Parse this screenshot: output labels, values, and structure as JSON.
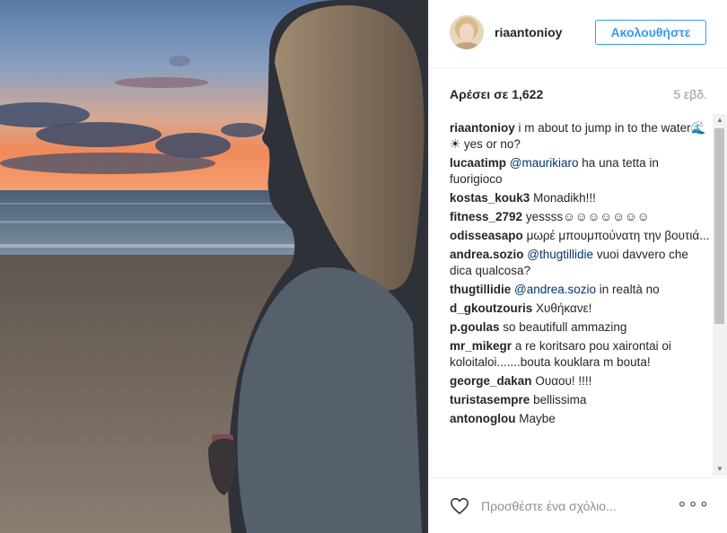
{
  "post": {
    "username": "riaantonioy",
    "follow_label": "Ακολουθήστε",
    "likes_text": "Αρέσει σε 1,622",
    "time_ago": "5 εβδ."
  },
  "comments": [
    {
      "user": "riaantonioy",
      "mention": "",
      "text": "i m about to jump in to the water🌊☀ yes or no?"
    },
    {
      "user": "lucaatimp",
      "mention": "@maurikiaro",
      "text": "ha una tetta in fuorigioco"
    },
    {
      "user": "kostas_kouk3",
      "mention": "",
      "text": "Monadikh!!!"
    },
    {
      "user": "fitness_2792",
      "mention": "",
      "text": "yessss☺☺☺☺☺☺☺"
    },
    {
      "user": "odisseasapo",
      "mention": "",
      "text": "μωρέ μπουμπούνατη την βουτιά..."
    },
    {
      "user": "andrea.sozio",
      "mention": "@thugtillidie",
      "text": "vuoi davvero che dica qualcosa?"
    },
    {
      "user": "thugtillidie",
      "mention": "@andrea.sozio",
      "text": "in realtà no"
    },
    {
      "user": "d_gkoutzouris",
      "mention": "",
      "text": "Χυθήκανε!"
    },
    {
      "user": "p.goulas",
      "mention": "",
      "text": "so beautifull ammazing"
    },
    {
      "user": "mr_mikegr",
      "mention": "",
      "text": "a re koritsaro pou xairontai oi koloitaloi.......bouta kouklara m bouta!"
    },
    {
      "user": "george_dakan",
      "mention": "",
      "text": "Ουαου! !!!!"
    },
    {
      "user": "turistasempre",
      "mention": "",
      "text": "bellissima"
    },
    {
      "user": "antonoglou",
      "mention": "",
      "text": "Maybe"
    }
  ],
  "footer": {
    "comment_placeholder": "Προσθέστε ένα σχόλιο...",
    "more_label": "∘∘∘"
  },
  "icons": {
    "like": "heart-icon",
    "more": "more-options-icon",
    "scroll_up": "scroll-up-arrow-icon",
    "scroll_down": "scroll-down-arrow-icon"
  },
  "colors": {
    "accent": "#3897f0",
    "mention": "#003569",
    "text": "#262626",
    "muted": "#999999",
    "border": "#efefef"
  }
}
